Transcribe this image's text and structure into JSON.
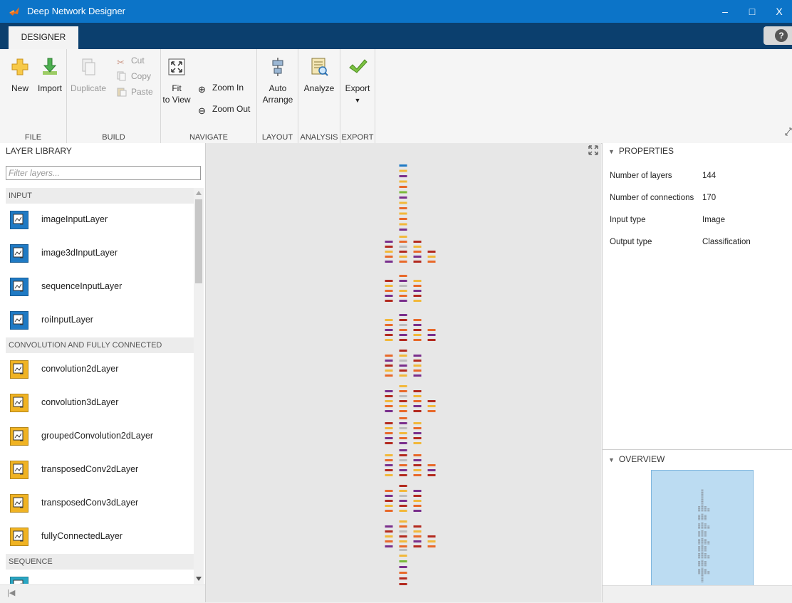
{
  "window": {
    "title": "Deep Network Designer",
    "controls": {
      "minimize": "–",
      "maximize": "□",
      "close": "X"
    }
  },
  "tabs": [
    {
      "label": "DESIGNER"
    }
  ],
  "help": "?",
  "ribbon": {
    "file": {
      "label": "FILE",
      "new": "New",
      "import": "Import"
    },
    "build": {
      "label": "BUILD",
      "duplicate": "Duplicate",
      "cut": "Cut",
      "copy": "Copy",
      "paste": "Paste"
    },
    "navigate": {
      "label": "NAVIGATE",
      "fit_line1": "Fit",
      "fit_line2": "to View",
      "zoom_in": "Zoom In",
      "zoom_out": "Zoom Out"
    },
    "layout": {
      "label": "LAYOUT",
      "auto_line1": "Auto",
      "auto_line2": "Arrange"
    },
    "analysis": {
      "label": "ANALYSIS",
      "analyze": "Analyze"
    },
    "export": {
      "label": "EXPORT",
      "export": "Export",
      "arrow": "▼"
    }
  },
  "library": {
    "title": "LAYER LIBRARY",
    "filter_placeholder": "Filter layers...",
    "categories": [
      {
        "name": "INPUT",
        "items": [
          "imageInputLayer",
          "image3dInputLayer",
          "sequenceInputLayer",
          "roiInputLayer"
        ]
      },
      {
        "name": "CONVOLUTION AND FULLY CONNECTED",
        "items": [
          "convolution2dLayer",
          "convolution3dLayer",
          "groupedConvolution2dLayer",
          "transposedConv2dLayer",
          "transposedConv3dLayer",
          "fullyConnectedLayer"
        ]
      },
      {
        "name": "SEQUENCE",
        "items": []
      }
    ],
    "icon_colors": {
      "input": "#1f7ac4",
      "conv": "#f0b323",
      "seq": "#2aa7c4"
    },
    "hscroll_start": "|◀"
  },
  "properties": {
    "title": "PROPERTIES",
    "rows": [
      {
        "label": "Number of layers",
        "value": "144"
      },
      {
        "label": "Number of connections",
        "value": "170"
      },
      {
        "label": "Input type",
        "value": "Image"
      },
      {
        "label": "Output type",
        "value": "Classification"
      }
    ]
  },
  "overview": {
    "title": "OVERVIEW"
  },
  "colors": {
    "titlebar": "#0c74c8",
    "tabstrip": "#0b3f6e",
    "layer_blue": "#1f7ac4",
    "layer_yellow": "#f2b83a",
    "layer_purple": "#7a2f8c",
    "layer_orange": "#e8692a",
    "layer_green": "#79b83a",
    "layer_red": "#b32a1f",
    "layer_gray": "#bdbdbd"
  }
}
